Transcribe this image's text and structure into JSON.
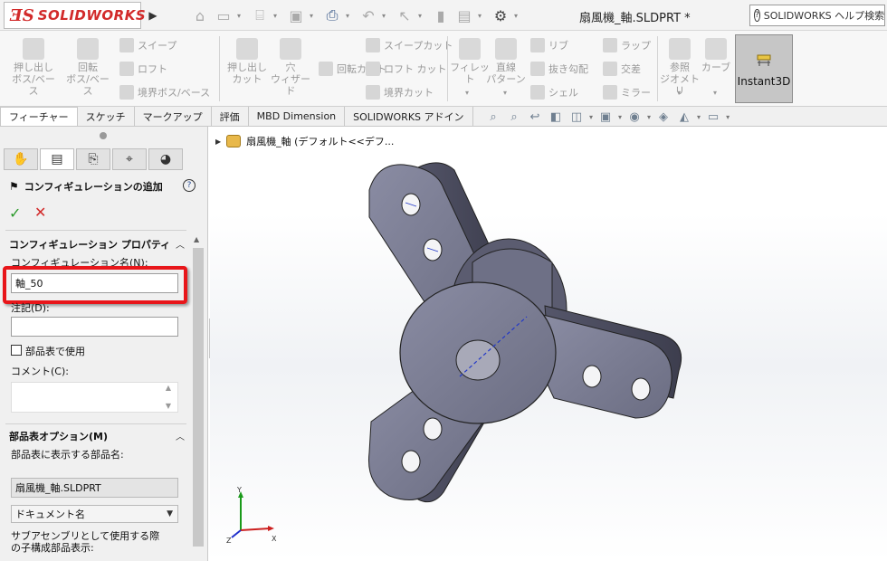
{
  "titlebar": {
    "logo_mark": "ƎS",
    "logo_text": "SOLIDWORKS",
    "doc_title": "扇風機_軸.SLDPRT *",
    "help_search": "SOLIDWORKS ヘルプ検索"
  },
  "ribbon": {
    "extrude_boss": "押し出し\nボス/ベース",
    "revolve_boss": "回転\nボス/ベース",
    "sweep": "スイープ",
    "loft": "ロフト",
    "boundary_boss": "境界ボス/ベース",
    "extrude_cut": "押し出し\nカット",
    "hole_wizard": "穴\nウィザード",
    "revolve_cut": "回転カット",
    "sweep_cut": "スイープカット",
    "loft_cut": "ロフト カット",
    "boundary_cut": "境界カット",
    "fillet": "フィレット",
    "linear_pattern": "直線\nパターン",
    "rib": "リブ",
    "draft": "抜き勾配",
    "shell": "シェル",
    "wrap": "ラップ",
    "intersect": "交差",
    "mirror": "ミラー",
    "ref_geometry": "参照\nジオメトリ",
    "curves": "カーブ",
    "instant3d": "Instant3D"
  },
  "tabs": [
    {
      "label": "フィーチャー",
      "active": true
    },
    {
      "label": "スケッチ"
    },
    {
      "label": "マークアップ"
    },
    {
      "label": "評価"
    },
    {
      "label": "MBD Dimension"
    },
    {
      "label": "SOLIDWORKS アドイン"
    }
  ],
  "panel": {
    "header": "コンフィギュレーションの追加",
    "section_config": "コンフィギュレーション プロパティ",
    "config_name_label": "コンフィギュレーション名(N):",
    "config_name_value": "軸_50",
    "description_label": "注記(D):",
    "description_value": "",
    "use_in_bom_label": "部品表で使用",
    "comment_label": "コメント(C):",
    "section_bom": "部品表オプション(M)",
    "bom_part_label": "部品表に表示する部品名:",
    "bom_part_value": "扇風機_軸.SLDPRT",
    "doc_name_select": "ドキュメント名",
    "subassembly_label_1": "サブアセンブリとして使用する際",
    "subassembly_label_2": "の子構成部品表示:"
  },
  "tree": {
    "item": "扇風機_軸 (デフォルト<<デフ..."
  },
  "triad": {
    "x": "X",
    "y": "Y",
    "z": "Z"
  },
  "colors": {
    "accent_red": "#e8161a",
    "model_face": "#7d7f94",
    "model_dark": "#4a4b5c"
  }
}
